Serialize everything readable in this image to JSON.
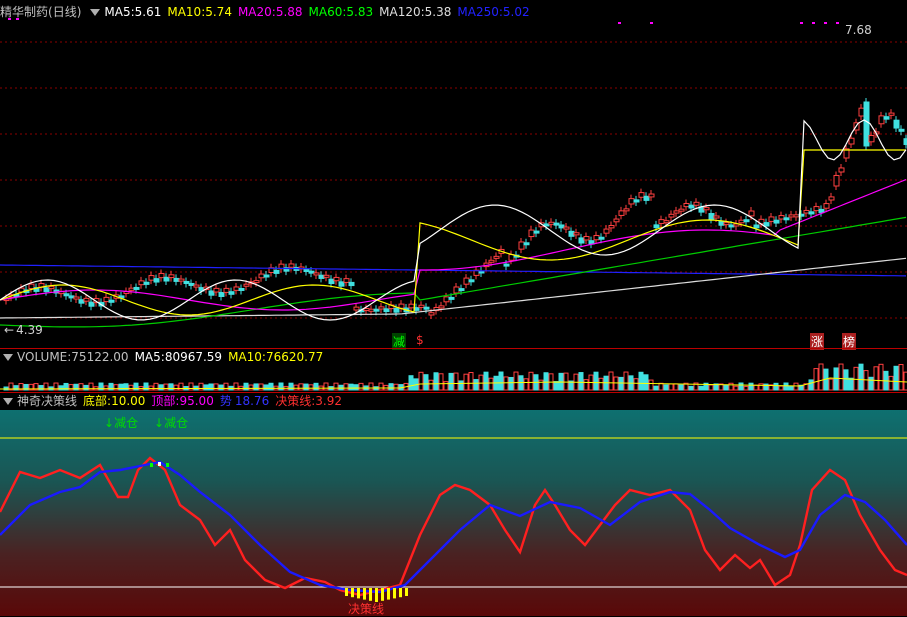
{
  "main": {
    "stock_name": "精华制药",
    "period": "(日线)",
    "ma": [
      {
        "label": "MA5:",
        "value": "5.61",
        "color": "#ffffff"
      },
      {
        "label": "MA10:",
        "value": "5.74",
        "color": "#ffff00"
      },
      {
        "label": "MA20:",
        "value": "5.88",
        "color": "#ff00ff"
      },
      {
        "label": "MA60:",
        "value": "5.83",
        "color": "#00ff00"
      },
      {
        "label": "MA120:",
        "value": "5.38",
        "color": "#dddddd"
      },
      {
        "label": "MA250:",
        "value": "5.02",
        "color": "#0000ff"
      }
    ],
    "high_label": "7.68",
    "low_label": "4.39",
    "signals": [
      {
        "text": "减",
        "color": "#00ff00"
      },
      {
        "text": "$",
        "color": "#ff3030"
      },
      {
        "text": "涨",
        "color": "#ff3030"
      },
      {
        "text": "榜",
        "color": "#ff3030"
      }
    ]
  },
  "volume": {
    "label": "VOLUME:",
    "value": "75122.00",
    "ma5_label": "MA5:",
    "ma5_value": "80967.59",
    "ma10_label": "MA10:",
    "ma10_value": "76620.77"
  },
  "indicator": {
    "name": "神奇决策线",
    "bottom_label": "底部:",
    "bottom_value": "10.00",
    "top_label": "顶部:",
    "top_value": "95.00",
    "mid_label": "势",
    "mid_value": "18.76",
    "line_label": "决策线:",
    "line_value": "3.92",
    "reduce_label_1": "减仓",
    "reduce_label_2": "减仓",
    "bottom_marker": "决策线"
  }
}
